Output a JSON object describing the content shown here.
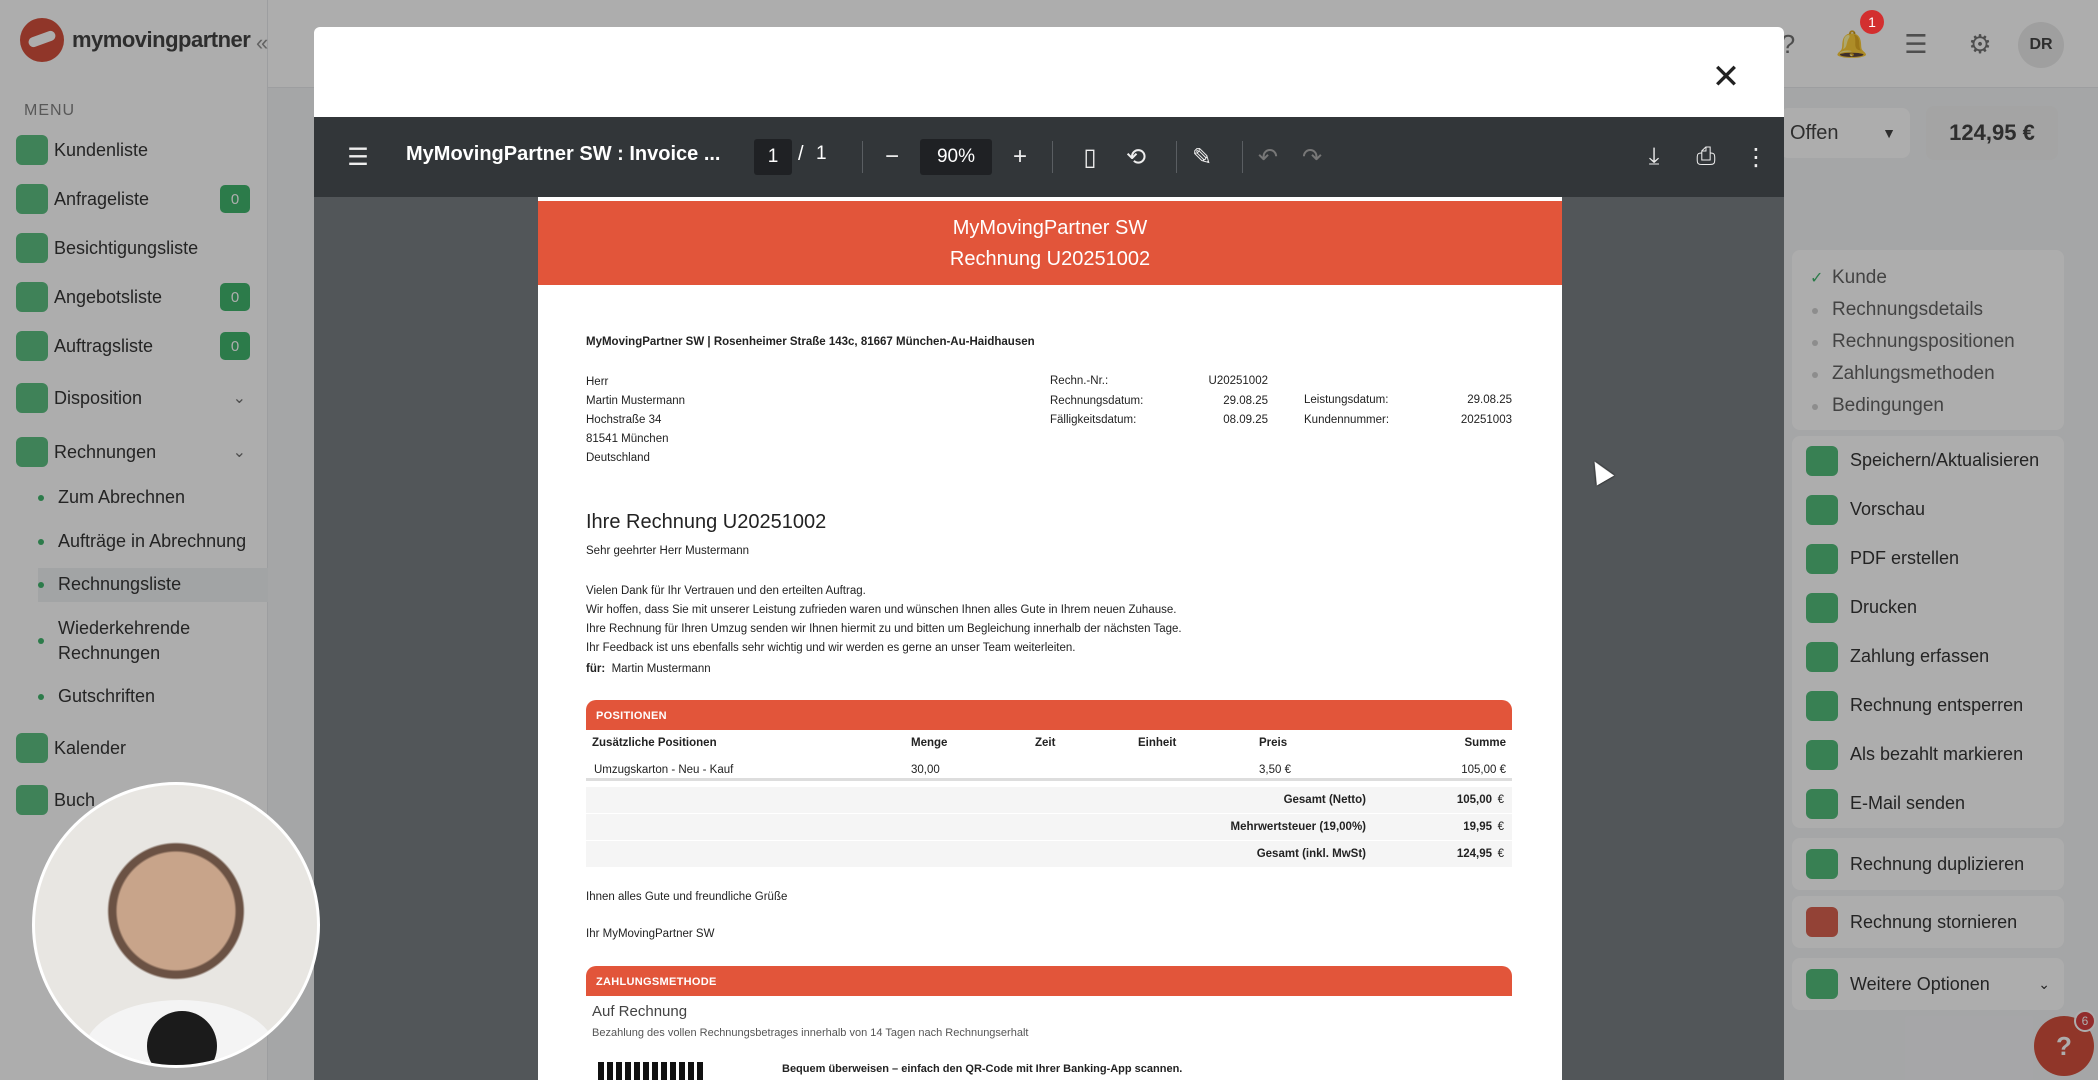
{
  "app": {
    "logo_text": "mymovingpartner",
    "menu_title": "MENU",
    "collapse_icon": "«"
  },
  "sidebar": {
    "items": [
      {
        "label": "Kundenliste",
        "badge": null
      },
      {
        "label": "Anfrageliste",
        "badge": "0"
      },
      {
        "label": "Besichtigungsliste",
        "badge": null
      },
      {
        "label": "Angebotsliste",
        "badge": "0"
      },
      {
        "label": "Auftragsliste",
        "badge": "0"
      },
      {
        "label": "Disposition",
        "badge": null
      },
      {
        "label": "Rechnungen",
        "badge": null
      }
    ],
    "sub_items": [
      {
        "label": "Zum Abrechnen"
      },
      {
        "label": "Aufträge in Abrechnung"
      },
      {
        "label": "Rechnungsliste"
      },
      {
        "label": "Wiederkehrende Rechnungen"
      },
      {
        "label": "Gutschriften"
      }
    ],
    "lower_items": [
      {
        "label": "Kalender"
      },
      {
        "label": "Buch"
      }
    ]
  },
  "topbar": {
    "notification_count": "1",
    "avatar_initials": "DR"
  },
  "invoice_panel": {
    "status": "Offen",
    "total": "124,95 €",
    "steps": [
      {
        "label": "Kunde",
        "done": true
      },
      {
        "label": "Rechnungsdetails",
        "done": false
      },
      {
        "label": "Rechnungspositionen",
        "done": false
      },
      {
        "label": "Zahlungsmethoden",
        "done": false
      },
      {
        "label": "Bedingungen",
        "done": false
      }
    ],
    "actions": [
      "Speichern/Aktualisieren",
      "Vorschau",
      "PDF erstellen",
      "Drucken",
      "Zahlung erfassen",
      "Rechnung entsperren",
      "Als bezahlt markieren",
      "E-Mail senden"
    ],
    "extra_actions": [
      "Rechnung duplizieren",
      "Rechnung stornieren",
      "Weitere Optionen"
    ],
    "help_label": "?",
    "help_badge": "6"
  },
  "modal": {
    "close_label": "✕"
  },
  "pdf_viewer": {
    "title": "MyMovingPartner SW : Invoice ...",
    "page_current": "1",
    "page_separator": "/",
    "page_total": "1",
    "zoom": "90%"
  },
  "invoice": {
    "header_line1": "MyMovingPartner SW",
    "header_line2": "Rechnung U20251002",
    "sender_line": "MyMovingPartner SW | Rosenheimer Straße 143c, 81667 München-Au-Haidhausen",
    "recipient": [
      "Herr",
      "Martin Mustermann",
      "Hochstraße 34",
      "81541 München",
      "Deutschland"
    ],
    "meta_left": [
      {
        "label": "Rechn.-Nr.:",
        "value": "U20251002"
      },
      {
        "label": "Rechnungsdatum:",
        "value": "29.08.25"
      },
      {
        "label": "Fälligkeitsdatum:",
        "value": "08.09.25"
      }
    ],
    "meta_right": [
      {
        "label": "Leistungsdatum:",
        "value": "29.08.25"
      },
      {
        "label": "Kundennummer:",
        "value": "20251003"
      }
    ],
    "heading": "Ihre Rechnung U20251002",
    "salutation": "Sehr geehrter Herr Mustermann",
    "body_lines": [
      "Vielen Dank für Ihr Vertrauen und den erteilten Auftrag.",
      "Wir hoffen, dass Sie mit unserer Leistung zufrieden waren und wünschen Ihnen alles Gute in Ihrem neuen Zuhause.",
      "Ihre Rechnung für Ihren Umzug senden wir Ihnen hiermit zu und bitten um Begleichung innerhalb der nächsten Tage.",
      "Ihr Feedback ist uns ebenfalls sehr wichtig und wir werden es gerne an unser Team weiterleiten."
    ],
    "for_label": "für:",
    "for_value": "Martin Mustermann",
    "positions_title": "POSITIONEN",
    "columns": [
      "Zusätzliche Positionen",
      "Menge",
      "Zeit",
      "Einheit",
      "Preis",
      "Summe"
    ],
    "rows": [
      {
        "name": "Umzugskarton - Neu - Kauf",
        "qty": "30,00",
        "time": "",
        "unit": "",
        "price": "3,50 €",
        "sum": "105,00 €"
      }
    ],
    "totals": [
      {
        "label": "Gesamt (Netto)",
        "value": "105,00",
        "cur": "€"
      },
      {
        "label": "Mehrwertsteuer (19,00%)",
        "value": "19,95",
        "cur": "€"
      },
      {
        "label": "Gesamt (inkl. MwSt)",
        "value": "124,95",
        "cur": "€"
      }
    ],
    "closing": "Ihnen alles Gute und freundliche Grüße",
    "signature": "Ihr MyMovingPartner SW",
    "payment_title": "ZAHLUNGSMETHODE",
    "payment_name": "Auf Rechnung",
    "payment_desc": "Bezahlung des vollen Rechnungsbetrages innerhalb von 14 Tagen nach Rechnungserhalt",
    "qr_text": "Bequem überweisen – einfach den QR-Code mit Ihrer Banking-App scannen."
  },
  "colors": {
    "accent": "#e2553a",
    "brand_green": "#2fae5f",
    "pdf_toolbar": "#323639"
  }
}
